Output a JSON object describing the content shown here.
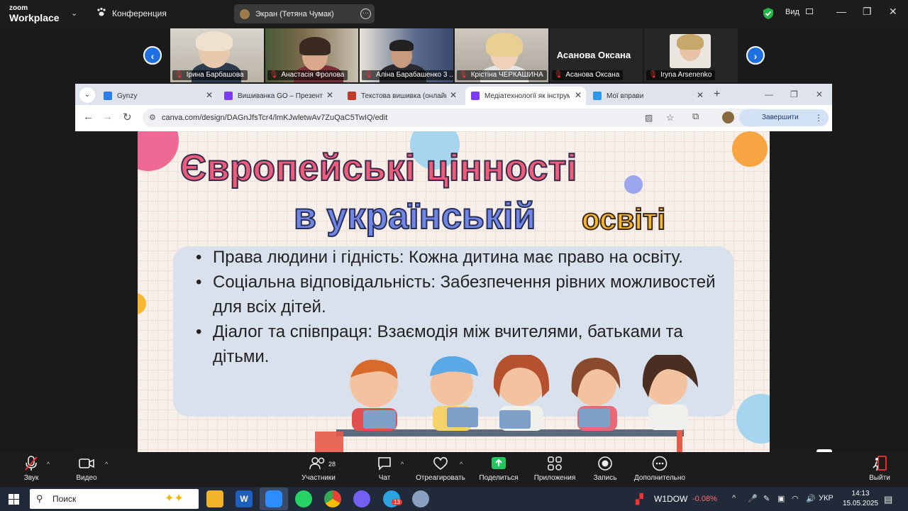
{
  "zoom": {
    "logo_line1": "zoom",
    "logo_line2": "Workplace",
    "conference_label": "Конференция",
    "share_label": "Экран (Тетяна Чумак)",
    "more_symbol": "···",
    "view_label": "Вид",
    "shield_color": "#27b34a"
  },
  "participants": [
    {
      "name": "Ірина Барбашова"
    },
    {
      "name": "Анастасія Фролова"
    },
    {
      "name": "Аліна Барабашенко 3 ..."
    },
    {
      "name": "Крістіна ЧЕРКАШИНА"
    },
    {
      "name": "Асанова Оксана",
      "big_name": "Асанова Оксана"
    },
    {
      "name": "Iryna Arsenenko"
    }
  ],
  "browser": {
    "tabs": [
      {
        "title": "Gynzy",
        "favicon_color": "#2b7de9"
      },
      {
        "title": "Вишиванка GO – Презентаці",
        "favicon_color": "#7d3cf0"
      },
      {
        "title": "Текстова вишивка (онлайн)",
        "favicon_color": "#c0392b"
      },
      {
        "title": "Медіатехнології як інструме",
        "favicon_color": "#7d3cf0",
        "active": true
      },
      {
        "title": "Мої вправи",
        "favicon_color": "#2b9be9"
      }
    ],
    "url": "canva.com/design/DAGnJfsTcr4/lmKJwletwAv7ZuQaC5TwIQ/edit",
    "finish_label": "Завершити оновлення"
  },
  "slide": {
    "title_line1": "Європейські цінності",
    "title_line2": "в українській",
    "title_line3": "освіті",
    "bullets": [
      "Права людини і гідність: Кожна дитина має право на освіту.",
      "Соціальна відповідальність: Забезпечення рівних можливостей для всіх дітей.",
      "Діалог та співпраця: Взаємодія між вчителями, батьками та дітьми."
    ]
  },
  "toolbar": {
    "audio": "Звук",
    "video": "Видео",
    "participants": "Участники",
    "participants_count": "28",
    "chat": "Чат",
    "react": "Отреагировать",
    "share": "Поделиться",
    "apps": "Приложения",
    "record": "Запись",
    "more": "Дополнительно",
    "leave": "Выйти"
  },
  "taskbar": {
    "search_placeholder": "Поиск",
    "stock_name": "W1DOW",
    "stock_change": "-0.08%",
    "language": "УКР",
    "time": "14:13",
    "date": "15.05.2025",
    "telegram_badge": "13"
  }
}
